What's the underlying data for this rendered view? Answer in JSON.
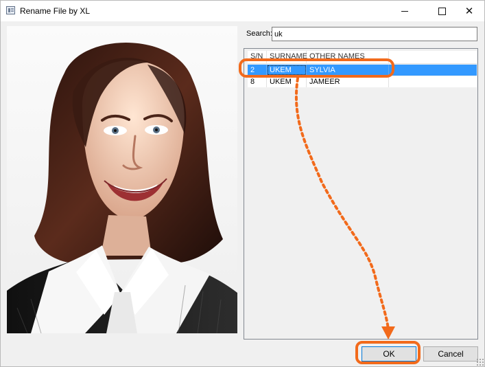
{
  "window": {
    "title": "Rename File by XL",
    "minimize_icon": "minimize-icon",
    "maximize_icon": "maximize-icon",
    "close_icon": "close-icon"
  },
  "search": {
    "label": "Search:",
    "value": "uk"
  },
  "list": {
    "columns": [
      "S/N",
      "SURNAME",
      "OTHER NAMES",
      ""
    ],
    "rows": [
      {
        "sn": "2",
        "surname": "UKEM",
        "other_names": "SYLVIA",
        "selected": true
      },
      {
        "sn": "8",
        "surname": "UKEM",
        "other_names": "JAMEER",
        "selected": false
      }
    ]
  },
  "buttons": {
    "ok": "OK",
    "cancel": "Cancel"
  },
  "colors": {
    "selection": "#3399ff",
    "annotation": "#f26a1b",
    "focus": "#0078d7"
  }
}
